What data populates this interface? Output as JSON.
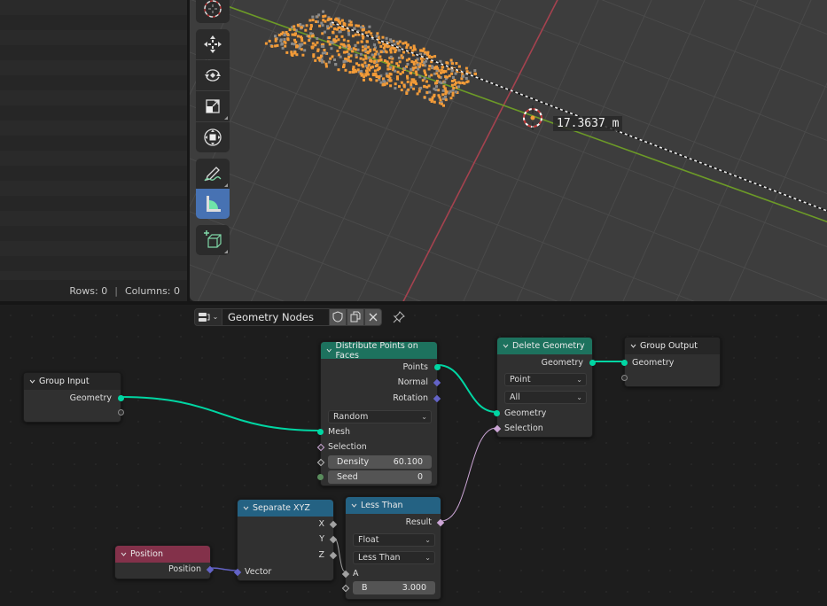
{
  "spreadsheet": {
    "rows_label": "Rows: 0",
    "columns_label": "Columns: 0",
    "separator": "|"
  },
  "viewport": {
    "tools": [
      {
        "name": "cursor-tool",
        "icon": "cursor-icon",
        "active": false
      },
      {
        "name": "move-tool",
        "icon": "move-icon",
        "active": false
      },
      {
        "name": "rotate-tool",
        "icon": "rotate-icon",
        "active": false
      },
      {
        "name": "scale-tool",
        "icon": "scale-icon",
        "active": false
      },
      {
        "name": "transform-tool",
        "icon": "transform-icon",
        "active": false
      },
      {
        "name": "annotate-tool",
        "icon": "annotate-icon",
        "active": false
      },
      {
        "name": "measure-tool",
        "icon": "measure-icon",
        "active": true
      },
      {
        "name": "add-cube-tool",
        "icon": "add-cube-icon",
        "active": false
      }
    ],
    "measurement": "17.3637 m",
    "colors": {
      "x_axis": "#a5424f",
      "y_axis": "#6c9a27",
      "points": "#f29b38",
      "background": "#3d3d3d",
      "active_tool": "#4772b3"
    }
  },
  "node_editor": {
    "header": {
      "node_tree_name": "Geometry Nodes",
      "type_icon": "node-tree-icon",
      "fake_user_icon": "shield-icon",
      "duplicate_icon": "duplicate-icon",
      "unlink_icon": "close-icon",
      "pin_icon": "pin-icon"
    },
    "nodes": {
      "group_input": {
        "title": "Group Input",
        "outputs": [
          "Geometry"
        ]
      },
      "distribute": {
        "title": "Distribute Points on Faces",
        "outputs": [
          "Points",
          "Normal",
          "Rotation"
        ],
        "mode": "Random",
        "inputs": [
          "Mesh",
          "Selection"
        ],
        "density_label": "Density",
        "density_value": "60.100",
        "seed_label": "Seed",
        "seed_value": "0"
      },
      "delete_geometry": {
        "title": "Delete Geometry",
        "output": "Geometry",
        "domain": "Point",
        "mode": "All",
        "inputs": [
          "Geometry",
          "Selection"
        ]
      },
      "group_output": {
        "title": "Group Output",
        "inputs": [
          "Geometry"
        ]
      },
      "separate_xyz": {
        "title": "Separate XYZ",
        "outputs": [
          "X",
          "Y",
          "Z"
        ],
        "input": "Vector"
      },
      "less_than": {
        "title": "Less Than",
        "output": "Result",
        "data_type": "Float",
        "operation": "Less Than",
        "input_a": "A",
        "b_label": "B",
        "b_value": "3.000"
      },
      "position": {
        "title": "Position",
        "output": "Position"
      }
    },
    "colors": {
      "geometry_socket": "#00d6a3",
      "vector_socket": "#6363c7",
      "bool_socket": "#cca6d6",
      "float_socket": "#a1a1a1",
      "int_socket": "#598c5c",
      "geometry_header": "#1d725e",
      "converter_header": "#246283",
      "input_header": "#83314a"
    }
  }
}
